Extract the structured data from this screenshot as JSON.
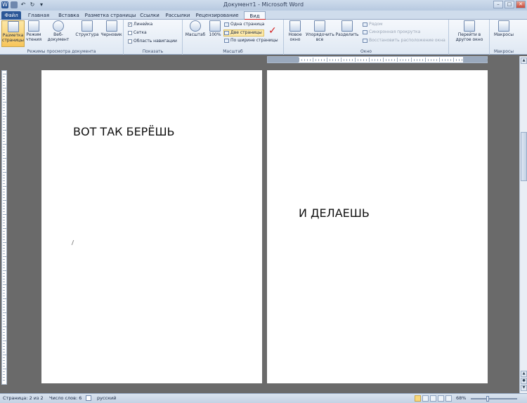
{
  "window": {
    "title": "Документ1 - Microsoft Word"
  },
  "tabs": [
    "Файл",
    "Главная",
    "Вставка",
    "Разметка страницы",
    "Ссылки",
    "Рассылки",
    "Рецензирование",
    "Вид"
  ],
  "ribbon": {
    "views": {
      "label": "Режимы просмотра документа",
      "print_layout": "Разметка страницы",
      "reading": "Режим чтения",
      "web": "Веб-документ",
      "outline": "Структура",
      "draft": "Черновик"
    },
    "show": {
      "label": "Показать",
      "ruler": "Линейка",
      "gridlines": "Сетка",
      "nav_pane": "Область навигации",
      "ruler_checked": true
    },
    "zoom": {
      "label": "Масштаб",
      "zoom": "Масштаб",
      "hundred": "100%",
      "one_page": "Одна страница",
      "two_pages": "Две страницы",
      "page_width": "По ширине страницы"
    },
    "window": {
      "label": "Окно",
      "new_window": "Новое окно",
      "arrange_all": "Упорядочить все",
      "split": "Разделить",
      "side_by_side": "Рядом",
      "sync_scroll": "Синхронная прокрутка",
      "reset_position": "Восстановить расположение окна",
      "switch": "Перейти в другое окно"
    },
    "macros": {
      "label": "Макросы",
      "macros": "Макросы"
    }
  },
  "pages": {
    "page1_text": "ВОТ ТАК БЕРЁШЬ",
    "page2_text": "И ДЕЛАЕШЬ"
  },
  "status": {
    "page": "Страница: 2 из 2",
    "words": "Число слов: 6",
    "language": "русский",
    "zoom": "68%"
  },
  "colors": {
    "accent": "#2b5797",
    "annotation": "#d42020"
  }
}
